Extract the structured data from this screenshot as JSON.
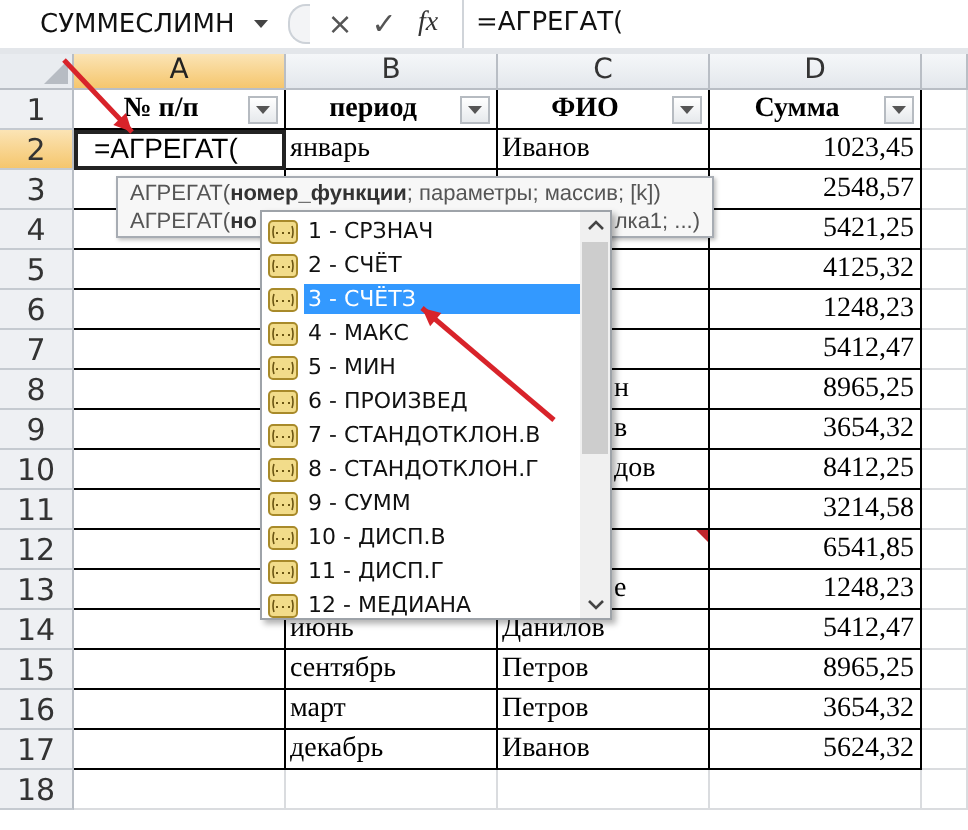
{
  "formula_bar": {
    "name_box": "СУММЕСЛИМН",
    "cancel": "×",
    "enter": "✓",
    "fx": "fx",
    "formula": "=АГРЕГАТ("
  },
  "columns": [
    {
      "label": "A",
      "selected": true
    },
    {
      "label": "B",
      "selected": false
    },
    {
      "label": "C",
      "selected": false
    },
    {
      "label": "D",
      "selected": false
    }
  ],
  "rows": [
    {
      "number": "1",
      "selected": false,
      "cells": [
        {
          "kind": "header",
          "text": "№ п/п"
        },
        {
          "kind": "header",
          "text": "период"
        },
        {
          "kind": "header",
          "text": "ФИО"
        },
        {
          "kind": "header",
          "text": "Сумма"
        }
      ]
    },
    {
      "number": "2",
      "selected": true,
      "cells": [
        {
          "kind": "formula",
          "text": "=АГРЕГАТ("
        },
        {
          "kind": "text",
          "text": "январь"
        },
        {
          "kind": "text",
          "text": "Иванов"
        },
        {
          "kind": "number",
          "text": "1023,45"
        }
      ]
    },
    {
      "number": "3",
      "selected": false,
      "cells": [
        {
          "kind": "empty"
        },
        {
          "kind": "empty"
        },
        {
          "kind": "empty"
        },
        {
          "kind": "number",
          "text": "2548,57"
        }
      ]
    },
    {
      "number": "4",
      "selected": false,
      "cells": [
        {
          "kind": "empty"
        },
        {
          "kind": "empty"
        },
        {
          "kind": "empty"
        },
        {
          "kind": "number",
          "text": "5421,25"
        }
      ]
    },
    {
      "number": "5",
      "selected": false,
      "cells": [
        {
          "kind": "empty"
        },
        {
          "kind": "empty"
        },
        {
          "kind": "empty"
        },
        {
          "kind": "number",
          "text": "4125,32"
        }
      ]
    },
    {
      "number": "6",
      "selected": false,
      "cells": [
        {
          "kind": "empty"
        },
        {
          "kind": "empty"
        },
        {
          "kind": "empty"
        },
        {
          "kind": "number",
          "text": "1248,23"
        }
      ]
    },
    {
      "number": "7",
      "selected": false,
      "cells": [
        {
          "kind": "empty"
        },
        {
          "kind": "empty"
        },
        {
          "kind": "empty"
        },
        {
          "kind": "number",
          "text": "5412,47"
        }
      ]
    },
    {
      "number": "8",
      "selected": false,
      "cells": [
        {
          "kind": "empty"
        },
        {
          "kind": "empty"
        },
        {
          "kind": "partial",
          "text": "н"
        },
        {
          "kind": "number",
          "text": "8965,25"
        }
      ]
    },
    {
      "number": "9",
      "selected": false,
      "cells": [
        {
          "kind": "empty"
        },
        {
          "kind": "empty"
        },
        {
          "kind": "partial",
          "text": "в"
        },
        {
          "kind": "number",
          "text": "3654,32"
        }
      ]
    },
    {
      "number": "10",
      "selected": false,
      "cells": [
        {
          "kind": "empty"
        },
        {
          "kind": "empty"
        },
        {
          "kind": "partial",
          "text": "дов"
        },
        {
          "kind": "number",
          "text": "8412,25"
        }
      ]
    },
    {
      "number": "11",
      "selected": false,
      "cells": [
        {
          "kind": "empty"
        },
        {
          "kind": "empty"
        },
        {
          "kind": "empty"
        },
        {
          "kind": "number",
          "text": "3214,58"
        }
      ]
    },
    {
      "number": "12",
      "selected": false,
      "cells": [
        {
          "kind": "empty"
        },
        {
          "kind": "empty"
        },
        {
          "kind": "empty",
          "comment": true
        },
        {
          "kind": "number",
          "text": "6541,85"
        }
      ]
    },
    {
      "number": "13",
      "selected": false,
      "cells": [
        {
          "kind": "empty"
        },
        {
          "kind": "empty"
        },
        {
          "kind": "partial",
          "text": "е"
        },
        {
          "kind": "number",
          "text": "1248,23"
        }
      ]
    },
    {
      "number": "14",
      "selected": false,
      "cells": [
        {
          "kind": "empty"
        },
        {
          "kind": "text",
          "text": "июнь"
        },
        {
          "kind": "text",
          "text": "Данилов"
        },
        {
          "kind": "number",
          "text": "5412,47"
        }
      ]
    },
    {
      "number": "15",
      "selected": false,
      "cells": [
        {
          "kind": "empty"
        },
        {
          "kind": "text",
          "text": "сентябрь"
        },
        {
          "kind": "text",
          "text": "Петров"
        },
        {
          "kind": "number",
          "text": "8965,25"
        }
      ]
    },
    {
      "number": "16",
      "selected": false,
      "cells": [
        {
          "kind": "empty"
        },
        {
          "kind": "text",
          "text": "март"
        },
        {
          "kind": "text",
          "text": "Петров"
        },
        {
          "kind": "number",
          "text": "3654,32"
        }
      ]
    },
    {
      "number": "17",
      "selected": false,
      "cells": [
        {
          "kind": "empty"
        },
        {
          "kind": "text",
          "text": "декабрь"
        },
        {
          "kind": "text",
          "text": "Иванов"
        },
        {
          "kind": "number",
          "text": "5624,32"
        }
      ]
    },
    {
      "number": "18",
      "selected": false
    }
  ],
  "tooltip": {
    "lines": [
      {
        "left": "АГРЕГАТ(**номер_функции**; параметры; массив; [k])"
      },
      {
        "left": "АГРЕГАТ(**но**",
        "right": "лка1; ...)"
      }
    ]
  },
  "autocomplete": {
    "items": [
      {
        "label": "1 - СРЗНАЧ",
        "selected": false
      },
      {
        "label": "2 - СЧЁТ",
        "selected": false
      },
      {
        "label": "3 - СЧЁТЗ",
        "selected": true
      },
      {
        "label": "4 - МАКС",
        "selected": false
      },
      {
        "label": "5 - МИН",
        "selected": false
      },
      {
        "label": "6 - ПРОИЗВЕД",
        "selected": false
      },
      {
        "label": "7 - СТАНДОТКЛОН.В",
        "selected": false
      },
      {
        "label": "8 - СТАНДОТКЛОН.Г",
        "selected": false
      },
      {
        "label": "9 - СУММ",
        "selected": false
      },
      {
        "label": "10 - ДИСП.В",
        "selected": false
      },
      {
        "label": "11 - ДИСП.Г",
        "selected": false
      },
      {
        "label": "12 - МЕДИАНА",
        "selected": false
      }
    ]
  }
}
